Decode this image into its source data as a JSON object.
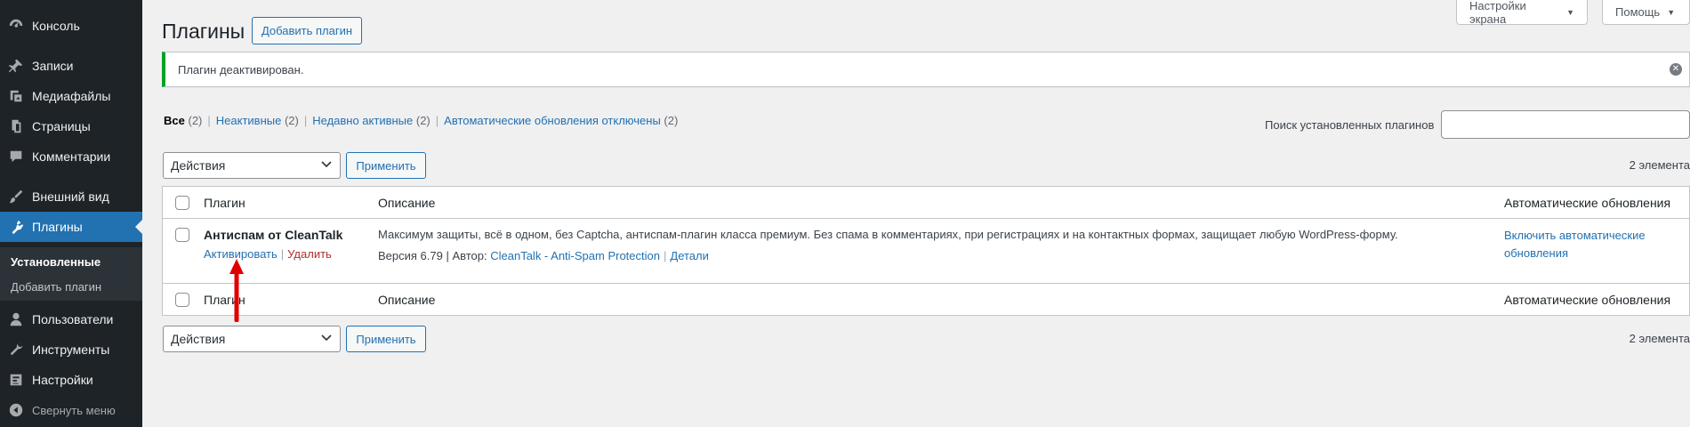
{
  "sidebar": {
    "items": [
      {
        "label": "Консоль",
        "icon": "dashboard-icon"
      },
      {
        "label": "Записи",
        "icon": "pushpin-icon"
      },
      {
        "label": "Медиафайлы",
        "icon": "media-icon"
      },
      {
        "label": "Страницы",
        "icon": "page-icon"
      },
      {
        "label": "Комментарии",
        "icon": "comment-icon"
      },
      {
        "label": "Внешний вид",
        "icon": "brush-icon"
      },
      {
        "label": "Плагины",
        "icon": "plugin-icon"
      },
      {
        "label": "Пользователи",
        "icon": "user-icon"
      },
      {
        "label": "Инструменты",
        "icon": "wrench-icon"
      },
      {
        "label": "Настройки",
        "icon": "settings-icon"
      }
    ],
    "submenu": [
      "Установленные",
      "Добавить плагин"
    ],
    "collapse_label": "Свернуть меню"
  },
  "header": {
    "title": "Плагины",
    "add_button": "Добавить плагин",
    "screen_options": "Настройки экрана",
    "help": "Помощь"
  },
  "notice": {
    "text": "Плагин деактивирован."
  },
  "filters": [
    {
      "label": "Все",
      "count": "(2)"
    },
    {
      "label": "Неактивные",
      "count": "(2)"
    },
    {
      "label": "Недавно активные",
      "count": "(2)"
    },
    {
      "label": "Автоматические обновления отключены",
      "count": "(2)"
    }
  ],
  "search": {
    "label": "Поиск установленных плагинов",
    "value": ""
  },
  "bulk": {
    "select_label": "Действия",
    "apply_label": "Применить",
    "count_label": "2 элемента"
  },
  "table": {
    "columns": [
      "Плагин",
      "Описание",
      "Автоматические обновления"
    ],
    "rows": [
      {
        "name": "Антиспам от CleanTalk",
        "action_activate": "Активировать",
        "action_delete": "Удалить",
        "description": "Максимум защиты, всё в одном, без Captcha, антиспам-плагин класса премиум. Без спама в комментариях, при регистрациях и на контактных формах, защищает любую WordPress-форму.",
        "version": "Версия 6.79 | Автор: ",
        "author": "CleanTalk - Anti-Spam Protection",
        "details": "Детали",
        "auto_update": "Включить автоматические обновления"
      }
    ]
  },
  "colors": {
    "accent": "#2271b1",
    "sidebar": "#1d2327",
    "notice_success": "#00a32a",
    "delete": "#b32d2e",
    "annotation_arrow": "#e00000"
  }
}
